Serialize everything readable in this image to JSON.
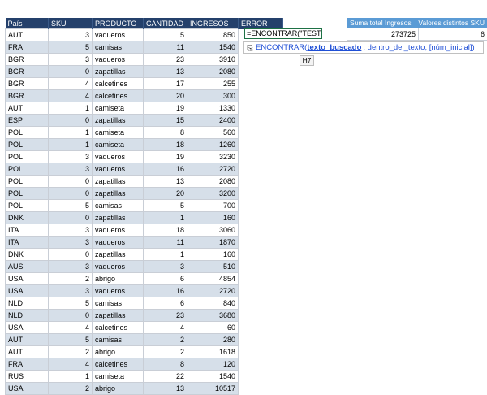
{
  "columns": [
    "País",
    "SKU",
    "PRODUCTO",
    "CANTIDAD",
    "INGRESOS",
    "ERROR"
  ],
  "rows": [
    [
      "AUT",
      "3",
      "vaqueros",
      "5",
      "850"
    ],
    [
      "FRA",
      "5",
      "camisas",
      "11",
      "1540"
    ],
    [
      "BGR",
      "3",
      "vaqueros",
      "23",
      "3910"
    ],
    [
      "BGR",
      "0",
      "zapatillas",
      "13",
      "2080"
    ],
    [
      "BGR",
      "4",
      "calcetines",
      "17",
      "255"
    ],
    [
      "BGR",
      "4",
      "calcetines",
      "20",
      "300"
    ],
    [
      "AUT",
      "1",
      "camiseta",
      "19",
      "1330"
    ],
    [
      "ESP",
      "0",
      "zapatillas",
      "15",
      "2400"
    ],
    [
      "POL",
      "1",
      "camiseta",
      "8",
      "560"
    ],
    [
      "POL",
      "1",
      "camiseta",
      "18",
      "1260"
    ],
    [
      "POL",
      "3",
      "vaqueros",
      "19",
      "3230"
    ],
    [
      "POL",
      "3",
      "vaqueros",
      "16",
      "2720"
    ],
    [
      "POL",
      "0",
      "zapatillas",
      "13",
      "2080"
    ],
    [
      "POL",
      "0",
      "zapatillas",
      "20",
      "3200"
    ],
    [
      "POL",
      "5",
      "camisas",
      "5",
      "700"
    ],
    [
      "DNK",
      "0",
      "zapatillas",
      "1",
      "160"
    ],
    [
      "ITA",
      "3",
      "vaqueros",
      "18",
      "3060"
    ],
    [
      "ITA",
      "3",
      "vaqueros",
      "11",
      "1870"
    ],
    [
      "DNK",
      "0",
      "zapatillas",
      "1",
      "160"
    ],
    [
      "AUS",
      "3",
      "vaqueros",
      "3",
      "510"
    ],
    [
      "USA",
      "2",
      "abrigo",
      "6",
      "4854"
    ],
    [
      "USA",
      "3",
      "vaqueros",
      "16",
      "2720"
    ],
    [
      "NLD",
      "5",
      "camisas",
      "6",
      "840"
    ],
    [
      "NLD",
      "0",
      "zapatillas",
      "23",
      "3680"
    ],
    [
      "USA",
      "4",
      "calcetines",
      "4",
      "60"
    ],
    [
      "AUT",
      "5",
      "camisas",
      "2",
      "280"
    ],
    [
      "AUT",
      "2",
      "abrigo",
      "2",
      "1618"
    ],
    [
      "FRA",
      "4",
      "calcetines",
      "8",
      "120"
    ],
    [
      "RUS",
      "1",
      "camiseta",
      "22",
      "1540"
    ],
    [
      "USA",
      "2",
      "abrigo",
      "13",
      "10517"
    ]
  ],
  "active_cell": {
    "formula": "=ENCONTRAR(\"TEST\"",
    "reference": "H7"
  },
  "tooltip": {
    "function_name": "ENCONTRAR",
    "open_paren": "(",
    "arg1": "texto_buscado",
    "rest": "; dentro_del_texto; [núm_inicial])",
    "icon": "paste-options-icon"
  },
  "summary": {
    "header_1": "Suma total Ingresos",
    "header_2": "Valores distintos SKU",
    "value_1": "273725",
    "value_2": "6"
  },
  "colors": {
    "header_bg": "#24406b",
    "summary_header_bg": "#5b9bd5",
    "alt_row_bg": "#d6dfe9",
    "active_border": "#1e7145",
    "tooltip_link": "#1f4fd6"
  }
}
